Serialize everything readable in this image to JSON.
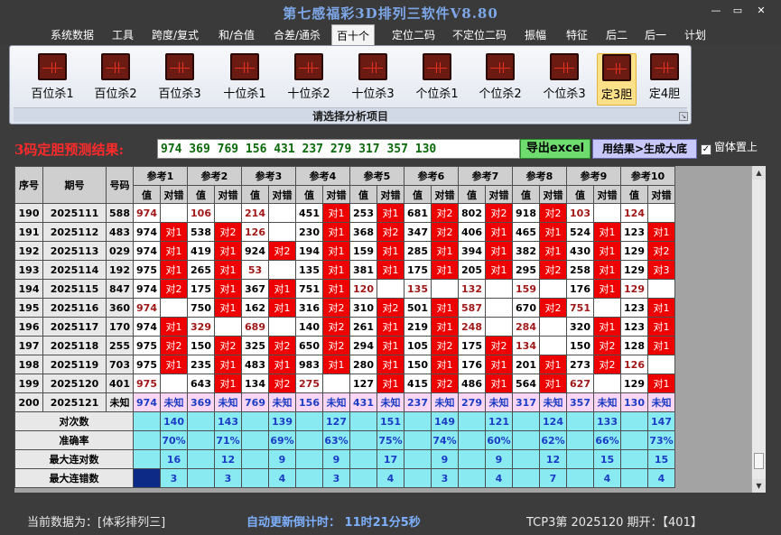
{
  "title": "第七感福彩3D排列三软件V8.80",
  "window_buttons": {
    "min": "—",
    "restore": "▭",
    "close": "✕"
  },
  "menu": [
    "系统数据",
    "工具",
    "跨度/复式",
    "和/合值",
    "合差/通杀",
    "百十个",
    "定位二码",
    "不定位二码",
    "振幅",
    "特征",
    "后二",
    "后一",
    "计划"
  ],
  "menu_active": "百十个",
  "ribbon": {
    "buttons": [
      "百位杀1",
      "百位杀2",
      "百位杀3",
      "十位杀1",
      "十位杀2",
      "十位杀3",
      "个位杀1",
      "个位杀2",
      "个位杀3",
      "定3胆",
      "定4胆"
    ],
    "selected": "定3胆",
    "group_label": "请选择分析项目"
  },
  "prediction": {
    "label": "3码定胆预测结果:",
    "value": "974 369 769 156 431 237 279 317 357 130",
    "export_button": "导出excel",
    "generate_button": "用结果>生成大底",
    "ontop_label": "窗体置上",
    "ontop_checked": true
  },
  "table": {
    "headers": {
      "seq": "序号",
      "period": "期号",
      "code": "号码",
      "refs": [
        "参考1",
        "参考2",
        "参考3",
        "参考4",
        "参考5",
        "参考6",
        "参考7",
        "参考8",
        "参考9",
        "参考10"
      ],
      "val": "值",
      "res": "对错"
    },
    "rows": [
      {
        "seq": "190",
        "period": "2025111",
        "code": "588",
        "cells": [
          [
            "974",
            ""
          ],
          [
            "106",
            ""
          ],
          [
            "214",
            ""
          ],
          [
            "451",
            "对1"
          ],
          [
            "253",
            "对1"
          ],
          [
            "681",
            "对2"
          ],
          [
            "802",
            "对2"
          ],
          [
            "918",
            "对2"
          ],
          [
            "103",
            ""
          ],
          [
            "124",
            ""
          ]
        ]
      },
      {
        "seq": "191",
        "period": "2025112",
        "code": "483",
        "cells": [
          [
            "974",
            "对1"
          ],
          [
            "538",
            "对2"
          ],
          [
            "126",
            ""
          ],
          [
            "230",
            "对1"
          ],
          [
            "368",
            "对2"
          ],
          [
            "347",
            "对2"
          ],
          [
            "406",
            "对1"
          ],
          [
            "465",
            "对1"
          ],
          [
            "524",
            "对1"
          ],
          [
            "123",
            "对1"
          ]
        ]
      },
      {
        "seq": "192",
        "period": "2025113",
        "code": "029",
        "cells": [
          [
            "974",
            "对1"
          ],
          [
            "419",
            "对1"
          ],
          [
            "924",
            "对2"
          ],
          [
            "194",
            "对1"
          ],
          [
            "159",
            "对1"
          ],
          [
            "285",
            "对1"
          ],
          [
            "394",
            "对1"
          ],
          [
            "382",
            "对1"
          ],
          [
            "430",
            "对1"
          ],
          [
            "129",
            "对2"
          ]
        ]
      },
      {
        "seq": "193",
        "period": "2025114",
        "code": "192",
        "cells": [
          [
            "975",
            "对1"
          ],
          [
            "265",
            "对1"
          ],
          [
            "53",
            ""
          ],
          [
            "135",
            "对1"
          ],
          [
            "381",
            "对1"
          ],
          [
            "175",
            "对1"
          ],
          [
            "205",
            "对1"
          ],
          [
            "295",
            "对2"
          ],
          [
            "258",
            "对1"
          ],
          [
            "129",
            "对3"
          ]
        ]
      },
      {
        "seq": "194",
        "period": "2025115",
        "code": "847",
        "cells": [
          [
            "974",
            "对2"
          ],
          [
            "175",
            "对1"
          ],
          [
            "367",
            "对1"
          ],
          [
            "751",
            "对1"
          ],
          [
            "120",
            ""
          ],
          [
            "135",
            ""
          ],
          [
            "132",
            ""
          ],
          [
            "159",
            ""
          ],
          [
            "176",
            "对1"
          ],
          [
            "129",
            ""
          ]
        ]
      },
      {
        "seq": "195",
        "period": "2025116",
        "code": "360",
        "cells": [
          [
            "974",
            ""
          ],
          [
            "750",
            "对1"
          ],
          [
            "162",
            "对1"
          ],
          [
            "316",
            "对2"
          ],
          [
            "310",
            "对2"
          ],
          [
            "501",
            "对1"
          ],
          [
            "587",
            ""
          ],
          [
            "670",
            "对2"
          ],
          [
            "751",
            ""
          ],
          [
            "123",
            "对1"
          ]
        ]
      },
      {
        "seq": "196",
        "period": "2025117",
        "code": "170",
        "cells": [
          [
            "974",
            "对1"
          ],
          [
            "329",
            ""
          ],
          [
            "689",
            ""
          ],
          [
            "140",
            "对2"
          ],
          [
            "261",
            "对1"
          ],
          [
            "219",
            "对1"
          ],
          [
            "248",
            ""
          ],
          [
            "284",
            ""
          ],
          [
            "320",
            "对1"
          ],
          [
            "123",
            "对1"
          ]
        ]
      },
      {
        "seq": "197",
        "period": "2025118",
        "code": "255",
        "cells": [
          [
            "975",
            "对2"
          ],
          [
            "150",
            "对2"
          ],
          [
            "325",
            "对2"
          ],
          [
            "650",
            "对2"
          ],
          [
            "294",
            "对1"
          ],
          [
            "105",
            "对2"
          ],
          [
            "175",
            "对2"
          ],
          [
            "134",
            ""
          ],
          [
            "150",
            "对2"
          ],
          [
            "128",
            "对1"
          ]
        ]
      },
      {
        "seq": "198",
        "period": "2025119",
        "code": "703",
        "cells": [
          [
            "975",
            "对1"
          ],
          [
            "235",
            "对1"
          ],
          [
            "483",
            "对1"
          ],
          [
            "983",
            "对1"
          ],
          [
            "280",
            "对1"
          ],
          [
            "150",
            "对1"
          ],
          [
            "176",
            "对1"
          ],
          [
            "201",
            "对1"
          ],
          [
            "273",
            "对2"
          ],
          [
            "126",
            ""
          ]
        ]
      },
      {
        "seq": "199",
        "period": "2025120",
        "code": "401",
        "cells": [
          [
            "975",
            ""
          ],
          [
            "643",
            "对1"
          ],
          [
            "134",
            "对2"
          ],
          [
            "275",
            ""
          ],
          [
            "127",
            "对1"
          ],
          [
            "415",
            "对2"
          ],
          [
            "486",
            "对1"
          ],
          [
            "564",
            "对1"
          ],
          [
            "627",
            ""
          ],
          [
            "129",
            "对1"
          ]
        ]
      }
    ],
    "unknown_row": {
      "seq": "200",
      "period": "2025121",
      "code": "未知",
      "cells": [
        [
          "974",
          "未知"
        ],
        [
          "369",
          "未知"
        ],
        [
          "769",
          "未知"
        ],
        [
          "156",
          "未知"
        ],
        [
          "431",
          "未知"
        ],
        [
          "237",
          "未知"
        ],
        [
          "279",
          "未知"
        ],
        [
          "317",
          "未知"
        ],
        [
          "357",
          "未知"
        ],
        [
          "130",
          "未知"
        ]
      ]
    },
    "stats": [
      {
        "label": "对次数",
        "values": [
          "140",
          "143",
          "139",
          "127",
          "151",
          "149",
          "121",
          "124",
          "133",
          "147"
        ]
      },
      {
        "label": "准确率",
        "values": [
          "70%",
          "71%",
          "69%",
          "63%",
          "75%",
          "74%",
          "60%",
          "62%",
          "66%",
          "73%"
        ]
      },
      {
        "label": "最大连对数",
        "values": [
          "16",
          "12",
          "9",
          "9",
          "17",
          "9",
          "9",
          "12",
          "15",
          "15"
        ]
      },
      {
        "label": "最大连错数",
        "values": [
          "3",
          "3",
          "4",
          "3",
          "4",
          "3",
          "4",
          "7",
          "4",
          "4"
        ]
      }
    ]
  },
  "status": {
    "left": "当前数据为：[体彩排列三]",
    "mid": "自动更新倒计时：  11时21分5秒",
    "right": "TCP3第 2025120 期开：【401】"
  },
  "colors": {
    "hit_red": "#ee0000",
    "stat_cyan": "#8aeaf2",
    "unknown_pink": "#fad6f4",
    "title_blue": "#7da7e8"
  }
}
